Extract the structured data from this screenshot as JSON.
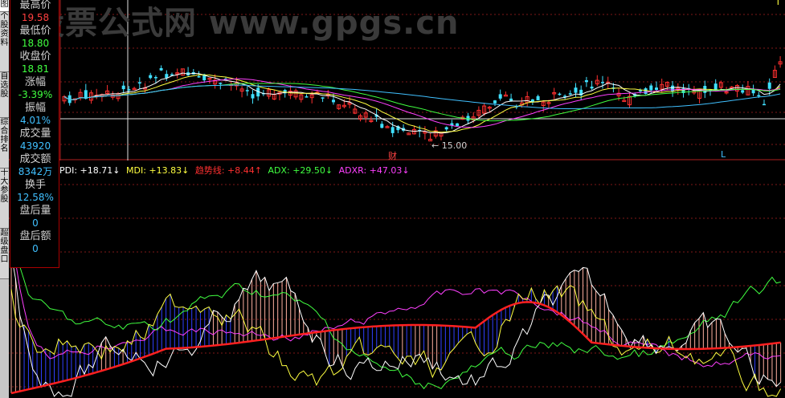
{
  "watermark": "股票公式网 www.gpgs.cn",
  "sidebar": {
    "tabs": [
      {
        "label": "图",
        "active": true
      },
      {
        "label": "个股资料",
        "active": false
      },
      {
        "label": "自选股",
        "active": false
      },
      {
        "label": "综合排名",
        "active": false
      },
      {
        "label": "十大参股",
        "active": false
      },
      {
        "label": "超级盘口",
        "active": false
      }
    ]
  },
  "quote": {
    "rows": [
      {
        "label": "最高价",
        "value": "19.58",
        "color": "#ff4040"
      },
      {
        "label": "最低价",
        "value": "18.80",
        "color": "#40ff40"
      },
      {
        "label": "收盘价",
        "value": "18.81",
        "color": "#40ff40"
      },
      {
        "label": "涨幅",
        "value": "-3.39%",
        "color": "#40ff40"
      },
      {
        "label": "振幅",
        "value": "4.01%",
        "color": "#40c0ff"
      },
      {
        "label": "成交量",
        "value": "43920",
        "color": "#40c0ff"
      },
      {
        "label": "成交额",
        "value": "8342万",
        "color": "#40c0ff"
      },
      {
        "label": "换手",
        "value": "12.58%",
        "color": "#40c0ff"
      },
      {
        "label": "盘后量",
        "value": "0",
        "color": "#40c0ff"
      },
      {
        "label": "盘后额",
        "value": "0",
        "color": "#40c0ff"
      }
    ]
  },
  "price_chart": {
    "low_marker": "15.00",
    "cai_marker": "财",
    "l_marker": "L",
    "t_marker": "T"
  },
  "indicator": {
    "items": [
      {
        "text": "PDI: +18.71↓",
        "color": "#ffffff"
      },
      {
        "text": "MDI: +13.83↓",
        "color": "#ffff40"
      },
      {
        "text": "趋势线: +8.44↑",
        "color": "#ff3030"
      },
      {
        "text": "ADX: +29.50↓",
        "color": "#40ff40"
      },
      {
        "text": "ADXR: +47.03↓",
        "color": "#ff40ff"
      }
    ]
  },
  "colors": {
    "up": "#ff3030",
    "down": "#40e0ff",
    "grid": "#801818"
  }
}
